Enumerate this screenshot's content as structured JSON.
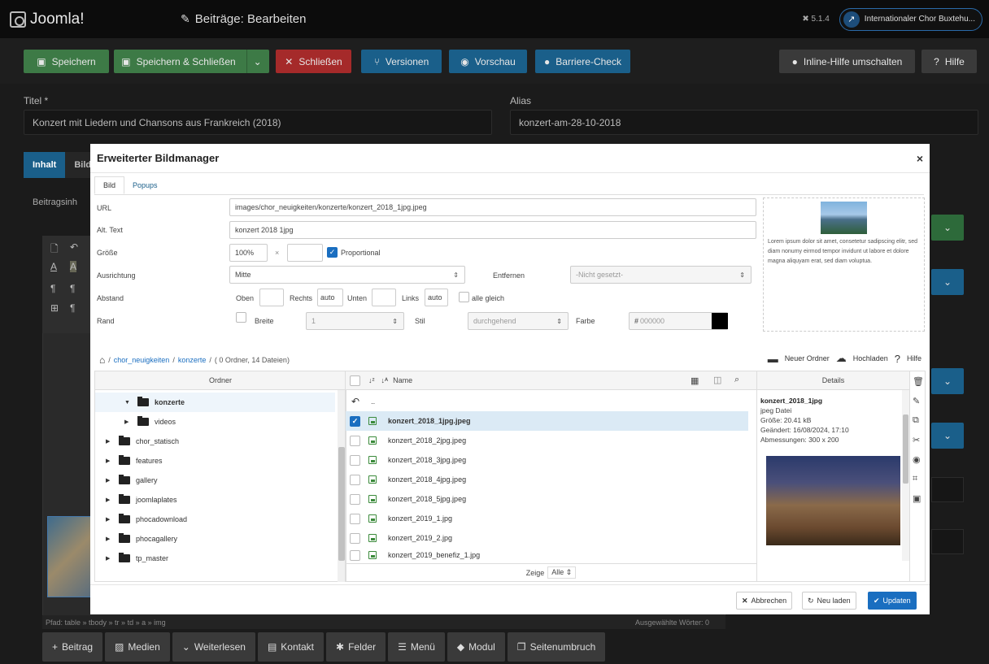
{
  "header": {
    "logo_text": "Joomla!",
    "page_title": "Beiträge: Bearbeiten",
    "version": "5.1.4",
    "site_name": "Internationaler Chor Buxtehu..."
  },
  "toolbar": {
    "save": "Speichern",
    "save_close": "Speichern & Schließen",
    "close": "Schließen",
    "versions": "Versionen",
    "preview": "Vorschau",
    "accessibility": "Barriere-Check",
    "inline_help": "Inline-Hilfe umschalten",
    "help": "Hilfe"
  },
  "form": {
    "title_label": "Titel *",
    "title_value": "Konzert mit Liedern und Chansons aus Frankreich (2018)",
    "alias_label": "Alias",
    "alias_value": "konzert-am-28-10-2018",
    "tabs": [
      "Inhalt",
      "Bild"
    ],
    "content_label": "Beitragsinh",
    "path_text": "Pfad: table » tbody » tr » td » a » img",
    "word_count": "Ausgewählte Wörter: 0"
  },
  "editor_buttons": [
    "Beitrag",
    "Medien",
    "Weiterlesen",
    "Kontakt",
    "Felder",
    "Menü",
    "Modul",
    "Seitenumbruch"
  ],
  "modal": {
    "title": "Erweiterter Bildmanager",
    "tabs": [
      "Bild",
      "Popups"
    ],
    "url_label": "URL",
    "url_value": "images/chor_neuigkeiten/konzerte/konzert_2018_1jpg.jpeg",
    "alt_label": "Alt. Text",
    "alt_value": "konzert 2018 1jpg",
    "size_label": "Größe",
    "width_value": "100%",
    "times": "×",
    "proportional": "Proportional",
    "align_label": "Ausrichtung",
    "align_value": "Mitte",
    "remove_label": "Entfernen",
    "remove_value": "-Nicht gesetzt-",
    "spacing_label": "Abstand",
    "top_label": "Oben",
    "right_label": "Rechts",
    "right_value": "auto",
    "bottom_label": "Unten",
    "left_label": "Links",
    "left_value": "auto",
    "equal_label": "alle gleich",
    "border_label": "Rand",
    "border_width_label": "Breite",
    "border_width_value": "1",
    "style_label": "Stil",
    "style_value": "durchgehend",
    "color_label": "Farbe",
    "color_value": "000000",
    "preview_text": "Lorem ipsum dolor sit amet, consetetur sadipscing elitr, sed diam nonumy eirmod tempor invidunt ut labore et dolore magna aliquyam erat, sed diam voluptua.",
    "crumb_root": "chor_neuigkeiten",
    "crumb_sub": "konzerte",
    "crumb_count": "( 0 Ordner, 14 Dateien)",
    "new_folder": "Neuer Ordner",
    "upload": "Hochladen",
    "help": "Hilfe",
    "folders_header": "Ordner",
    "folders": [
      {
        "name": "konzerte",
        "bold": true
      },
      {
        "name": "videos"
      },
      {
        "name": "chor_statisch"
      },
      {
        "name": "features"
      },
      {
        "name": "gallery"
      },
      {
        "name": "joomlaplates"
      },
      {
        "name": "phocadownload"
      },
      {
        "name": "phocagallery"
      },
      {
        "name": "tp_master"
      }
    ],
    "name_header": "Name",
    "up_label": "..",
    "files": [
      "konzert_2018_1jpg.jpeg",
      "konzert_2018_2jpg.jpeg",
      "konzert_2018_3jpg.jpeg",
      "konzert_2018_4jpg.jpeg",
      "konzert_2018_5jpg.jpeg",
      "konzert_2019_1.jpg",
      "konzert_2019_2.jpg",
      "konzert_2019_benefiz_1.jpg"
    ],
    "show_label": "Zeige",
    "show_value": "Alle",
    "details_header": "Details",
    "detail_name": "konzert_2018_1jpg",
    "detail_type": "jpeg Datei",
    "detail_size": "Größe: 20.41 kB",
    "detail_changed": "Geändert: 16/08/2024, 17:10",
    "detail_dims": "Abmessungen: 300 x 200",
    "cancel": "Abbrechen",
    "reload": "Neu laden",
    "update": "Updaten"
  }
}
